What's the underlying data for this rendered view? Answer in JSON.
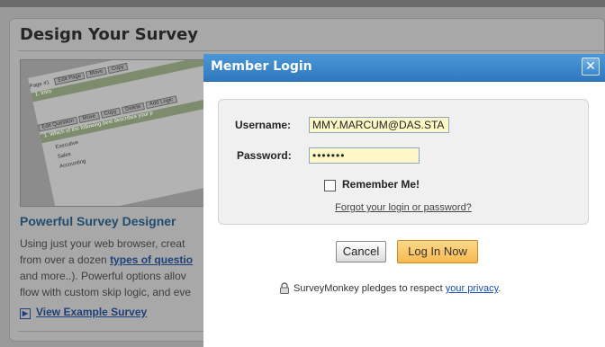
{
  "background": {
    "title": "Design Your Survey",
    "image_tabs": [
      "Edit Page",
      "Move",
      "Copy"
    ],
    "image_page_label": "Page #1",
    "image_intro": "1. Intro",
    "image_buttons": [
      "Edit Question",
      "Move",
      "Copy",
      "Delete",
      "Add Logic"
    ],
    "image_question": "1. Which of the following best describes your p",
    "image_options": [
      "Executive",
      "Sales",
      "Accounting"
    ],
    "subheading": "Powerful Survey Designer",
    "text_lines": [
      "Using just your web browser, creat",
      "from over a dozen ",
      "and more..). Powerful options allov",
      "flow with custom skip logic, and eve"
    ],
    "text_link": "types of questio",
    "example_link": "View Example Survey"
  },
  "modal": {
    "title": "Member Login",
    "close_label": "✕",
    "username_label": "Username:",
    "username_value": "MMY.MARCUM@DAS.STA",
    "password_label": "Password:",
    "password_value": "•••••••",
    "remember_label": "Remember Me!",
    "remember_checked": false,
    "forgot_link": "Forgot your login or password?",
    "cancel_label": "Cancel",
    "login_label": "Log In Now",
    "pledge_text": "SurveyMonkey pledges to respect ",
    "pledge_link": "your privacy",
    "pledge_end": "."
  },
  "colors": {
    "header_blue": "#3a86cc",
    "login_button": "#f7b94f",
    "input_fill": "#fdf8c6"
  }
}
